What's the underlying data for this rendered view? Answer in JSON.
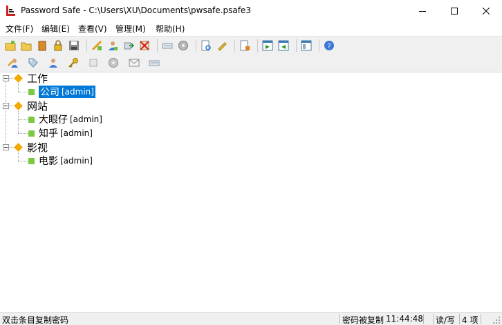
{
  "window": {
    "title": "Password Safe - C:\\Users\\XU\\Documents\\pwsafe.psafe3"
  },
  "menu": {
    "items": [
      {
        "label": "文件(F)"
      },
      {
        "label": "编辑(E)"
      },
      {
        "label": "查看(V)"
      },
      {
        "label": "管理(M)"
      },
      {
        "label": "帮助(H)"
      }
    ]
  },
  "toolbar1": {
    "icons": [
      "new-db-icon",
      "open-db-icon",
      "close-db-icon",
      "lock-icon",
      "save-icon",
      "add-entry-icon",
      "edit-entry-icon",
      "delete-entry-icon",
      "delete-red-icon",
      "keyboard-icon",
      "disk-icon",
      "find-icon",
      "pencil-icon",
      "report-icon",
      "export-icon",
      "import-icon",
      "options-icon",
      "help-icon"
    ]
  },
  "toolbar2": {
    "icons": [
      "copy-user-icon",
      "tag-icon",
      "user-icon",
      "key-icon",
      "notes-icon",
      "disk-gray-icon",
      "email-icon",
      "keyboard-gray-icon"
    ]
  },
  "tree": {
    "groups": [
      {
        "label": "工作",
        "entries": [
          {
            "title": "公司",
            "user": "[admin]",
            "selected": true
          }
        ]
      },
      {
        "label": "网站",
        "entries": [
          {
            "title": "大眼仔",
            "user": "[admin]"
          },
          {
            "title": "知乎",
            "user": "[admin]"
          }
        ]
      },
      {
        "label": "影视",
        "entries": [
          {
            "title": "电影",
            "user": "[admin]"
          }
        ]
      }
    ]
  },
  "status": {
    "hint": "双击条目复制密码",
    "copied": "密码被复制",
    "time": "11:44:48",
    "mode": "读/写",
    "count": "4 项"
  },
  "colors": {
    "selection": "#0078d7",
    "group_icon": "#f5a800",
    "entry_icon": "#7ac943"
  }
}
